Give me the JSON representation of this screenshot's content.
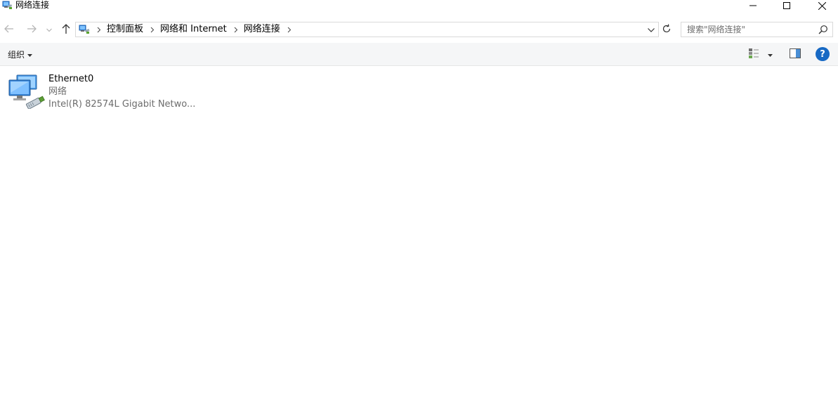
{
  "window": {
    "title": "网络连接",
    "icon": "network-connections-icon",
    "controls": {
      "minimize": "minimize-icon",
      "maximize": "maximize-icon",
      "close": "close-icon"
    }
  },
  "nav": {
    "back": "back-arrow-icon",
    "forward": "forward-arrow-icon",
    "recent": "chevron-down-icon",
    "up": "up-arrow-icon",
    "breadcrumbs": [
      "控制面板",
      "网络和 Internet",
      "网络连接"
    ],
    "refresh": "refresh-icon",
    "search": {
      "placeholder": "搜索\"网络连接\"",
      "value": ""
    }
  },
  "command_bar": {
    "organize_label": "组织",
    "change_view": "view-options-icon",
    "preview_pane": "preview-pane-icon",
    "help": "?"
  },
  "connections": [
    {
      "name": "Ethernet0",
      "status": "网络",
      "device": "Intel(R) 82574L Gigabit Netwo...",
      "icon": "ethernet-adapter-icon"
    }
  ],
  "colors": {
    "help_blue": "#1769c4",
    "cmdbar_bg": "#f5f6f7",
    "secondary_text": "#6d6d6d"
  }
}
